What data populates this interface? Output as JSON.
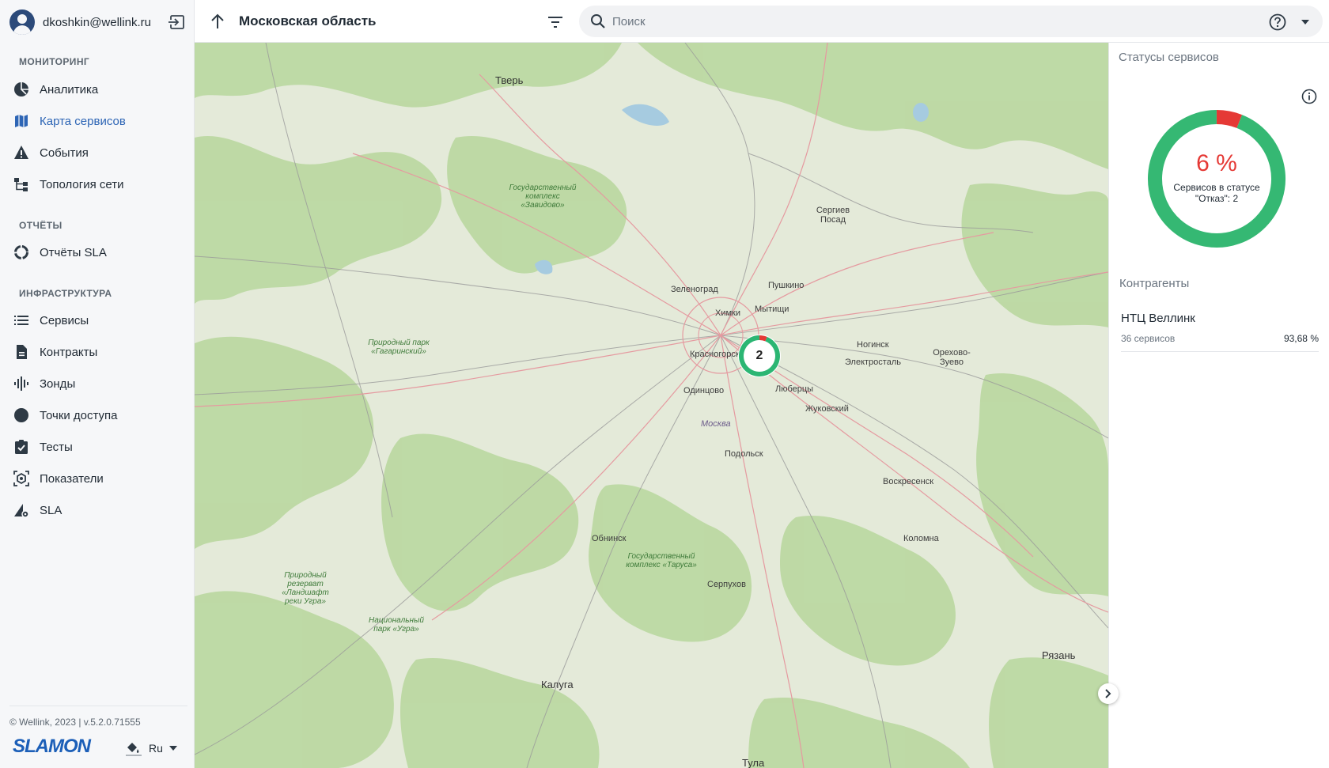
{
  "user": {
    "email": "dkoshkin@wellink.ru"
  },
  "sidebar": {
    "sections": [
      {
        "title": "МОНИТОРИНГ"
      },
      {
        "title": "ОТЧЁТЫ"
      },
      {
        "title": "ИНФРАСТРУКТУРА"
      }
    ],
    "items": [
      {
        "label": "Аналитика",
        "icon": "analytics-icon"
      },
      {
        "label": "Карта сервисов",
        "icon": "map-icon",
        "active": true
      },
      {
        "label": "События",
        "icon": "warning-icon"
      },
      {
        "label": "Топология сети",
        "icon": "topology-icon"
      },
      {
        "label": "Отчёты SLA",
        "icon": "sla-report-icon"
      },
      {
        "label": "Сервисы",
        "icon": "list-icon"
      },
      {
        "label": "Контракты",
        "icon": "document-icon"
      },
      {
        "label": "Зонды",
        "icon": "probe-icon"
      },
      {
        "label": "Точки доступа",
        "icon": "circle-icon"
      },
      {
        "label": "Тесты",
        "icon": "test-icon"
      },
      {
        "label": "Показатели",
        "icon": "metrics-icon"
      },
      {
        "label": "SLA",
        "icon": "sla-icon"
      }
    ],
    "footer": {
      "copyright": "© Wellink, 2023 | v.5.2.0.71555",
      "logo": "SLAMON",
      "language": "Ru"
    }
  },
  "header": {
    "region": "Московская область",
    "search_placeholder": "Поиск"
  },
  "map": {
    "cities": [
      {
        "name": "Тверь",
        "big": true
      },
      {
        "name": "Сергиев Посад"
      },
      {
        "name": "Зеленоград"
      },
      {
        "name": "Пушкино"
      },
      {
        "name": "Химки"
      },
      {
        "name": "Мытищи"
      },
      {
        "name": "Красногорск"
      },
      {
        "name": "Ногинск"
      },
      {
        "name": "Электросталь"
      },
      {
        "name": "Орехово-Зуево"
      },
      {
        "name": "Одинцово"
      },
      {
        "name": "Люберцы"
      },
      {
        "name": "Жуковский"
      },
      {
        "name": "Москва"
      },
      {
        "name": "Подольск"
      },
      {
        "name": "Воскресенск"
      },
      {
        "name": "Обнинск"
      },
      {
        "name": "Коломна"
      },
      {
        "name": "Серпухов"
      },
      {
        "name": "Рязань",
        "big": true
      },
      {
        "name": "Калуга",
        "big": true
      },
      {
        "name": "Тула",
        "big": true
      }
    ],
    "parks": [
      {
        "name": "Государственный комплекс «Завидово»"
      },
      {
        "name": "Природный парк «Гагаринский»"
      },
      {
        "name": "Государственный комплекс «Таруса»"
      },
      {
        "name": "Природный резерват «Ландшафт реки Угра»"
      },
      {
        "name": "Национальный парк «Угра»"
      }
    ],
    "cluster": {
      "count": "2",
      "ok_fraction": 0.94,
      "fail_fraction": 0.06,
      "ok_color": "#2bb673",
      "fail_color": "#e53935"
    }
  },
  "panel": {
    "status_title": "Статусы сервисов",
    "donut": {
      "percent_label": "6 %",
      "caption": "Сервисов в статусе \"Отказ\": 2",
      "fail_fraction": 0.06,
      "ok_color": "#35b873",
      "fail_color": "#e53935"
    },
    "contractors_title": "Контрагенты",
    "contractors": [
      {
        "name": "НТЦ Веллинк",
        "services": "36 сервисов",
        "percent": "93,68 %"
      }
    ]
  }
}
